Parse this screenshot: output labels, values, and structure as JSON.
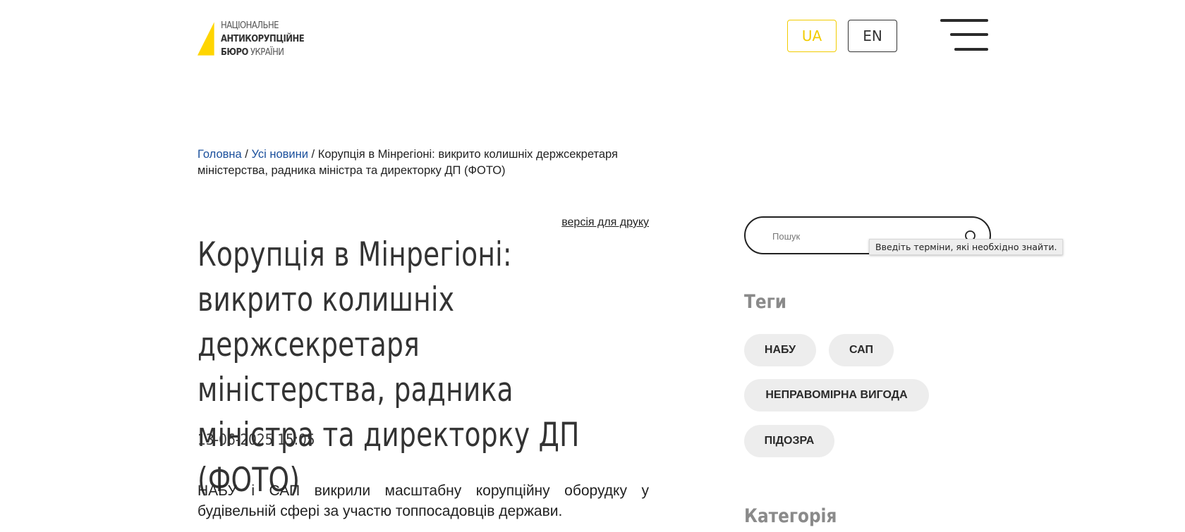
{
  "header": {
    "logo": {
      "line1": "НАЦІОНАЛЬНЕ",
      "line2": "АНТИКОРУПЦІЙНЕ",
      "line3_bold": "БЮРО",
      "line3_rest": " УКРАЇНИ",
      "accent_color": "#FFD500"
    },
    "lang_ua": "UA",
    "lang_en": "EN",
    "menu_icon": "hamburger-menu-icon"
  },
  "breadcrumb": {
    "home": "Головна",
    "sep1": " / ",
    "news": "Усі новини",
    "sep2": " / ",
    "current": "Корупція в Мінрегіоні: викрито колишніх держсекретаря міністерства, радника міністра та директорку ДП (ФОТО)"
  },
  "article": {
    "print_link": "версія для друку",
    "title": "Корупція в Мінрегіоні: викрито колишніх держсекретаря міністерства, радника міністра та директорку ДП (ФОТО)",
    "date": "13-06-2025 15:05",
    "lead": "НАБУ і САП викрили масштабну корупційну оборудку у будівельній сфері за участю топпосадовців держави."
  },
  "sidebar": {
    "search": {
      "placeholder": "Пошук",
      "value": "",
      "tooltip": "Введіть терміни, які необхідно знайти.",
      "icon": "search-icon"
    },
    "tags_heading": "Теги",
    "tags": [
      "НАБУ",
      "САП",
      "НЕПРАВОМІРНА ВИГОДА",
      "ПІДОЗРА"
    ],
    "category_heading": "Категорія"
  },
  "colors": {
    "accent_yellow": "#F2CC00",
    "link_blue": "#1A4F9C",
    "tag_bg": "#EDEDED",
    "heading_gray": "#8A8A8A"
  }
}
